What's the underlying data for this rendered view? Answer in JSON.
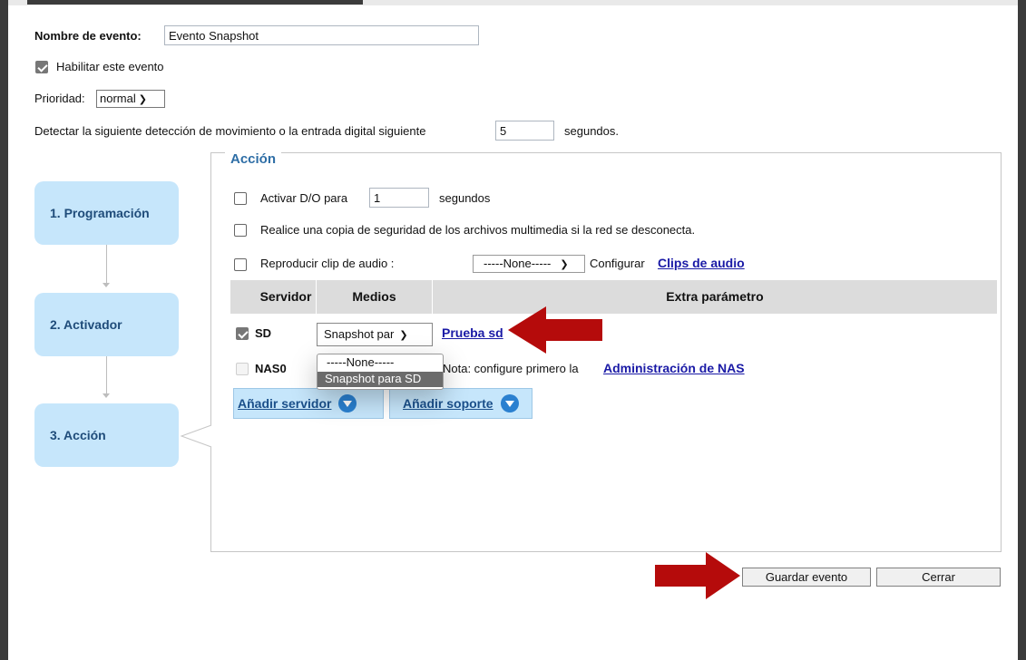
{
  "event": {
    "name_label": "Nombre de evento:",
    "name_value": "Evento Snapshot",
    "enable_label": "Habilitar este evento",
    "enable_checked": true,
    "priority_label": "Prioridad:",
    "priority_value": "normal",
    "detect_label": "Detectar la siguiente detección de movimiento o la entrada digital siguiente",
    "detect_value": "5",
    "detect_unit": "segundos."
  },
  "steps": [
    {
      "label": "1. Programación"
    },
    {
      "label": "2. Activador"
    },
    {
      "label": "3. Acción"
    }
  ],
  "action": {
    "legend": "Acción",
    "do_label": "Activar D/O para",
    "do_value": "1",
    "do_unit": "segundos",
    "backup_label": "Realice una copia de seguridad de los archivos multimedia si la red se desconecta.",
    "audio_label": "Reproducir clip de audio :",
    "audio_select": "-----None-----",
    "audio_config": "Configurar",
    "audio_link": "Clips de audio"
  },
  "table": {
    "headers": [
      "Servidor",
      "Medios",
      "Extra parámetro"
    ],
    "rows": [
      {
        "server": "SD",
        "checked": true,
        "media": "Snapshot par",
        "extra_link": "Prueba sd"
      },
      {
        "server": "NAS0",
        "checked": false,
        "note": "Nota: configure primero la",
        "note_link": "Administración de NAS"
      }
    ]
  },
  "dropdown": {
    "options": [
      "-----None-----",
      "Snapshot para SD"
    ],
    "selected": "Snapshot para SD"
  },
  "buttons": {
    "add_server": "Añadir servidor",
    "add_media": "Añadir soporte",
    "save": "Guardar evento",
    "close": "Cerrar"
  },
  "colors": {
    "accent_blue": "#2e6ea6",
    "step_bg": "#c6e6fb",
    "link": "#1a1aa6",
    "annotation_arrow": "#b50b0b"
  }
}
